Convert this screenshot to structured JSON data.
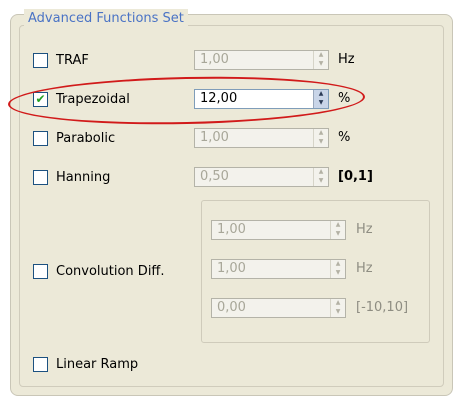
{
  "group": {
    "title": "Advanced Functions Set"
  },
  "rows": {
    "traf": {
      "label": "TRAF",
      "checked": false,
      "value": "1,00",
      "unit": "Hz"
    },
    "trapezoidal": {
      "label": "Trapezoidal",
      "checked": true,
      "value": "12,00",
      "unit": "%"
    },
    "parabolic": {
      "label": "Parabolic",
      "checked": false,
      "value": "1,00",
      "unit": "%"
    },
    "hanning": {
      "label": "Hanning",
      "checked": false,
      "value": "0,50",
      "unit": "[0,1]"
    },
    "convolution": {
      "label": "Convolution Diff.",
      "checked": false,
      "fields": [
        {
          "value": "1,00",
          "unit": "Hz"
        },
        {
          "value": "1,00",
          "unit": "Hz"
        },
        {
          "value": "0,00",
          "unit": "[-10,10]"
        }
      ]
    },
    "linear_ramp": {
      "label": "Linear Ramp",
      "checked": false
    }
  },
  "glyphs": {
    "check": "✔",
    "spin_up": "▲",
    "spin_down": "▼"
  },
  "colors": {
    "group_title": "#4a73c5",
    "highlight": "#d11a1a",
    "check_mark": "#21a121"
  }
}
